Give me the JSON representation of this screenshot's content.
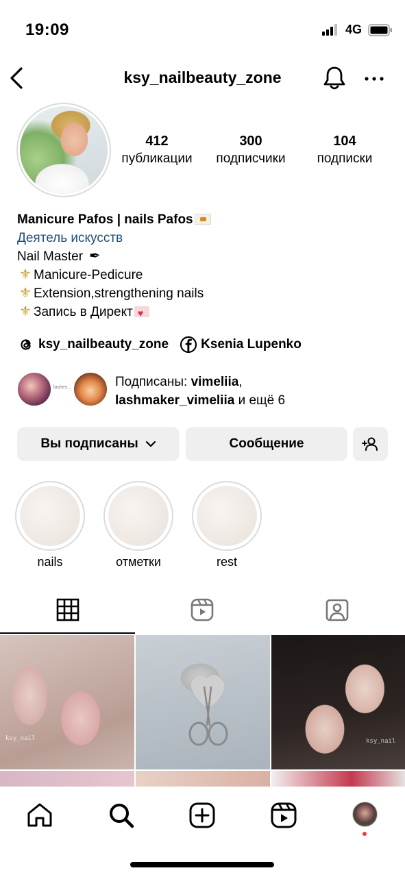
{
  "status": {
    "time": "19:09",
    "network": "4G"
  },
  "header": {
    "username": "ksy_nailbeauty_zone"
  },
  "stats": [
    {
      "value": "412",
      "label": "публикации"
    },
    {
      "value": "300",
      "label": "подписчики"
    },
    {
      "value": "104",
      "label": "подписки"
    }
  ],
  "bio": {
    "name": "Manicure Pafos | nails Pafos",
    "category": "Деятель искусств",
    "line1": "Nail Master",
    "line2": "Manicure-Pedicure",
    "line3": "Extension,strengthening nails",
    "line4": "Запись в Директ"
  },
  "links": {
    "threads": "ksy_nailbeauty_zone",
    "facebook": "Ksenia Lupenko"
  },
  "followed_by": {
    "prefix": "Подписаны: ",
    "user1": "vimeliia",
    "sep": ",",
    "user2": "lashmaker_vimeliia",
    "suffix": " и ещё 6",
    "mini_caption": "lashes..."
  },
  "actions": {
    "following": "Вы подписаны",
    "message": "Сообщение"
  },
  "highlights": [
    {
      "label": "nails"
    },
    {
      "label": "отметки"
    },
    {
      "label": "rest"
    }
  ],
  "posts": {
    "watermark": "ksy_nail"
  },
  "icons": {
    "back": "back-chevron-icon",
    "bell": "bell-icon",
    "more": "more-icon",
    "grid": "grid-icon",
    "reels": "reels-icon",
    "tagged": "tagged-icon",
    "home": "home-icon",
    "search": "search-icon",
    "create": "create-icon"
  },
  "colors": {
    "category": "#1b4e7a",
    "button_bg": "#efefef",
    "notification_dot": "#ff3040"
  }
}
